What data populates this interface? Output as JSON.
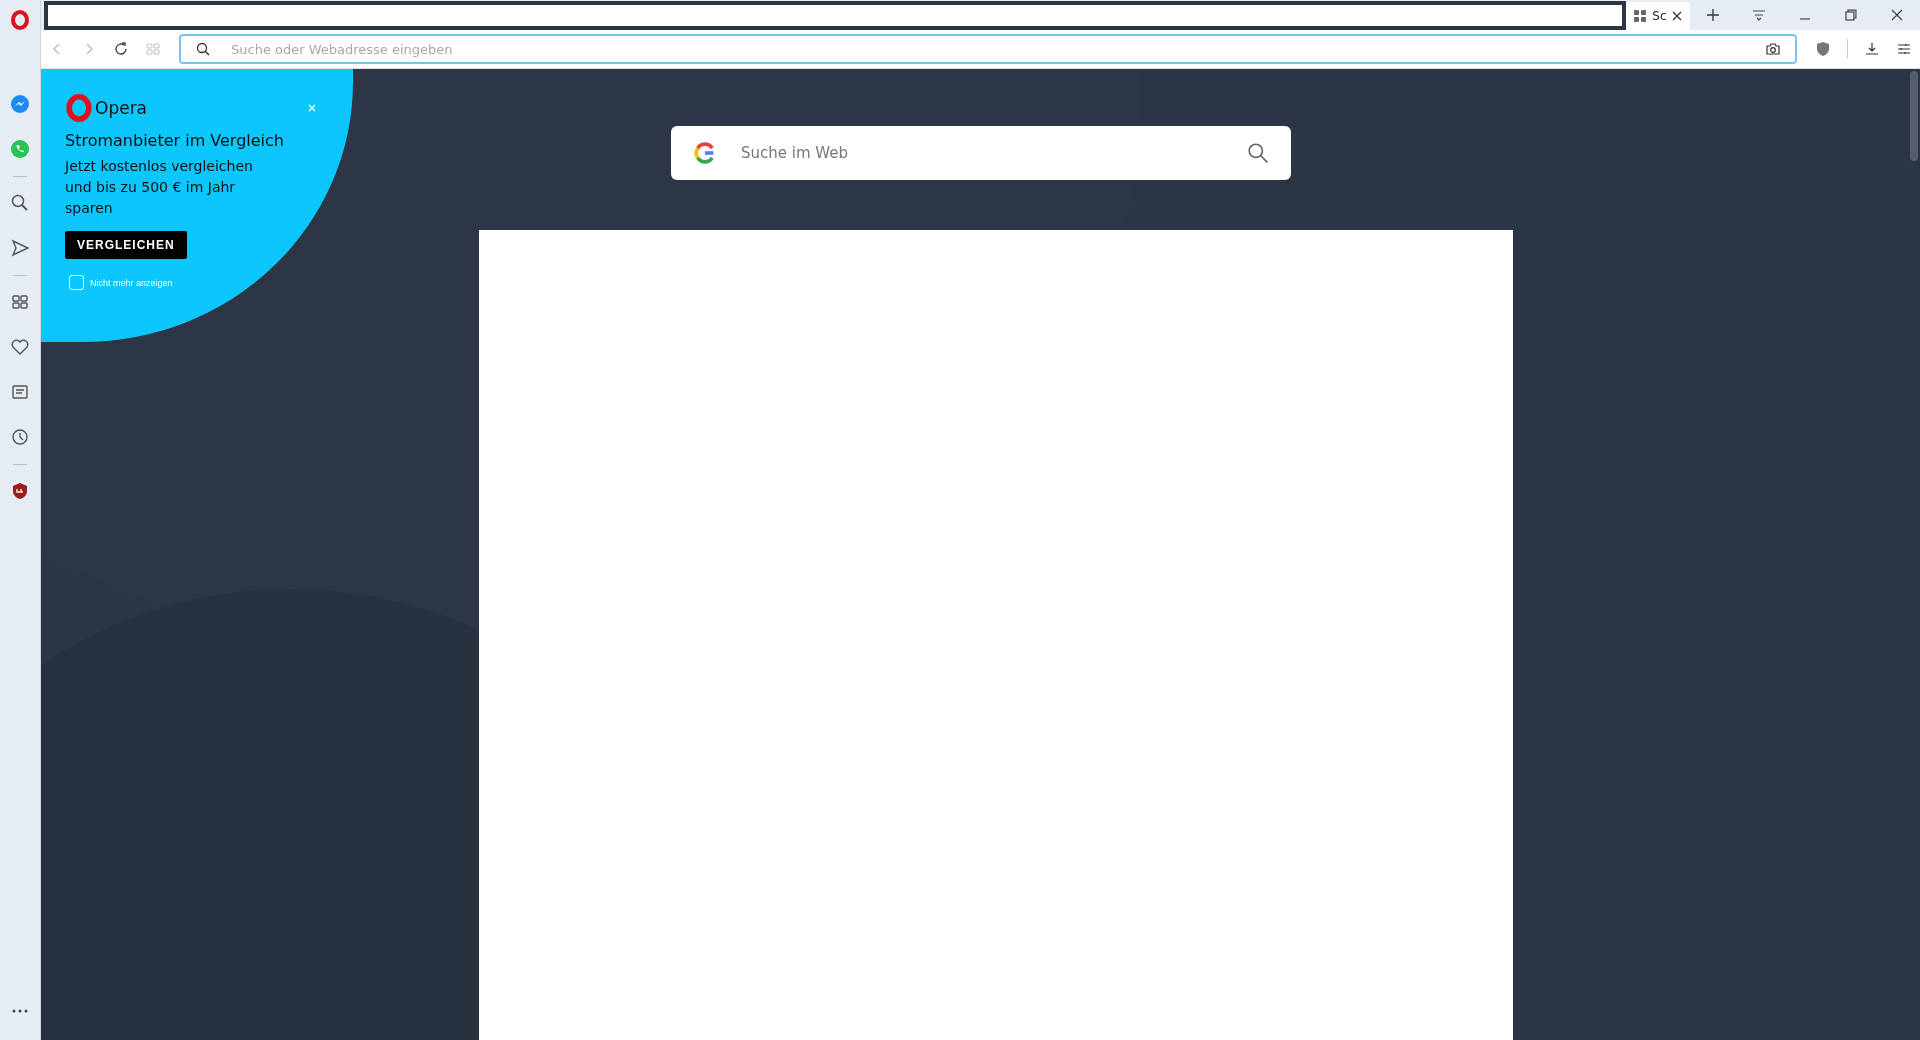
{
  "tabs": [
    {
      "title": "Sc",
      "selected": true
    }
  ],
  "address_bar": {
    "placeholder": "Suche oder Webadresse eingeben"
  },
  "promo": {
    "brand": "Opera",
    "title": "Stromanbieter im Vergleich",
    "text": "Jetzt kostenlos vergleichen und bis zu 500 € im Jahr sparen",
    "button": "VERGLEICHEN",
    "dont_show_again": {
      "label": "Nicht mehr anzeigen",
      "checked": false
    }
  },
  "search": {
    "placeholder": "Suche im Web"
  }
}
